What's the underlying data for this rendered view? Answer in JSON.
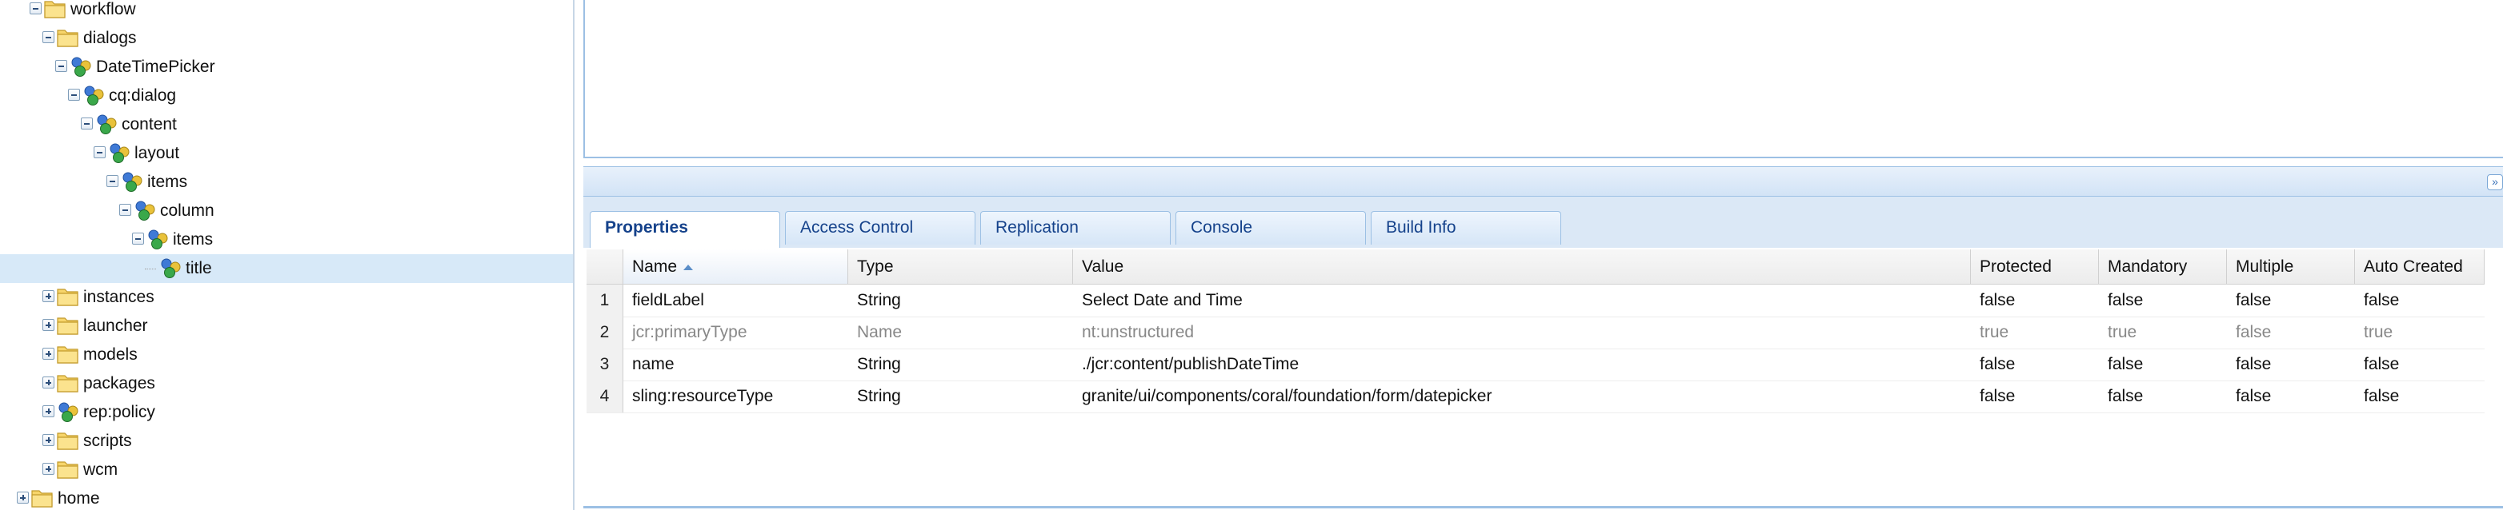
{
  "tree": {
    "nodes": [
      {
        "label": "workflow",
        "type": "folder",
        "state": "expanded"
      },
      {
        "label": "dialogs",
        "type": "folder",
        "state": "expanded"
      },
      {
        "label": "DateTimePicker",
        "type": "node",
        "state": "expanded"
      },
      {
        "label": "cq:dialog",
        "type": "node",
        "state": "expanded"
      },
      {
        "label": "content",
        "type": "node",
        "state": "expanded"
      },
      {
        "label": "layout",
        "type": "node",
        "state": "expanded"
      },
      {
        "label": "items",
        "type": "node",
        "state": "expanded"
      },
      {
        "label": "column",
        "type": "node",
        "state": "expanded"
      },
      {
        "label": "items",
        "type": "node",
        "state": "expanded"
      },
      {
        "label": "title",
        "type": "node",
        "state": "leaf",
        "selected": true
      },
      {
        "label": "instances",
        "type": "folder",
        "state": "collapsed"
      },
      {
        "label": "launcher",
        "type": "folder",
        "state": "collapsed"
      },
      {
        "label": "models",
        "type": "folder",
        "state": "collapsed"
      },
      {
        "label": "packages",
        "type": "folder",
        "state": "collapsed"
      },
      {
        "label": "rep:policy",
        "type": "node",
        "state": "collapsed"
      },
      {
        "label": "scripts",
        "type": "folder",
        "state": "collapsed"
      },
      {
        "label": "wcm",
        "type": "folder",
        "state": "collapsed"
      },
      {
        "label": "home",
        "type": "folder",
        "state": "collapsed"
      }
    ]
  },
  "tabs": [
    {
      "label": "Properties",
      "active": true
    },
    {
      "label": "Access Control",
      "active": false
    },
    {
      "label": "Replication",
      "active": false
    },
    {
      "label": "Console",
      "active": false
    },
    {
      "label": "Build Info",
      "active": false
    }
  ],
  "grid": {
    "columns": [
      "Name",
      "Type",
      "Value",
      "Protected",
      "Mandatory",
      "Multiple",
      "Auto Created"
    ],
    "sorted_column": "Name",
    "sort_direction": "ascending",
    "rows": [
      {
        "num": "1",
        "name": "fieldLabel",
        "type": "String",
        "value": "Select Date and Time",
        "protected": "false",
        "mandatory": "false",
        "multiple": "false",
        "auto_created": "false",
        "dim": false
      },
      {
        "num": "2",
        "name": "jcr:primaryType",
        "type": "Name",
        "value": "nt:unstructured",
        "protected": "true",
        "mandatory": "true",
        "multiple": "false",
        "auto_created": "true",
        "dim": true
      },
      {
        "num": "3",
        "name": "name",
        "type": "String",
        "value": "./jcr:content/publishDateTime",
        "protected": "false",
        "mandatory": "false",
        "multiple": "false",
        "auto_created": "false",
        "dim": false
      },
      {
        "num": "4",
        "name": "sling:resourceType",
        "type": "String",
        "value": "granite/ui/components/coral/foundation/form/datepicker",
        "protected": "false",
        "mandatory": "false",
        "multiple": "false",
        "auto_created": "false",
        "dim": false
      }
    ]
  },
  "icons": {
    "folder": "folder-icon",
    "node": "node-icon",
    "collapse": "double-chevron-down-icon"
  },
  "colors": {
    "selection": "#d7e9f8",
    "tab_text": "#15428b",
    "panel_border": "#9cc0e4"
  }
}
